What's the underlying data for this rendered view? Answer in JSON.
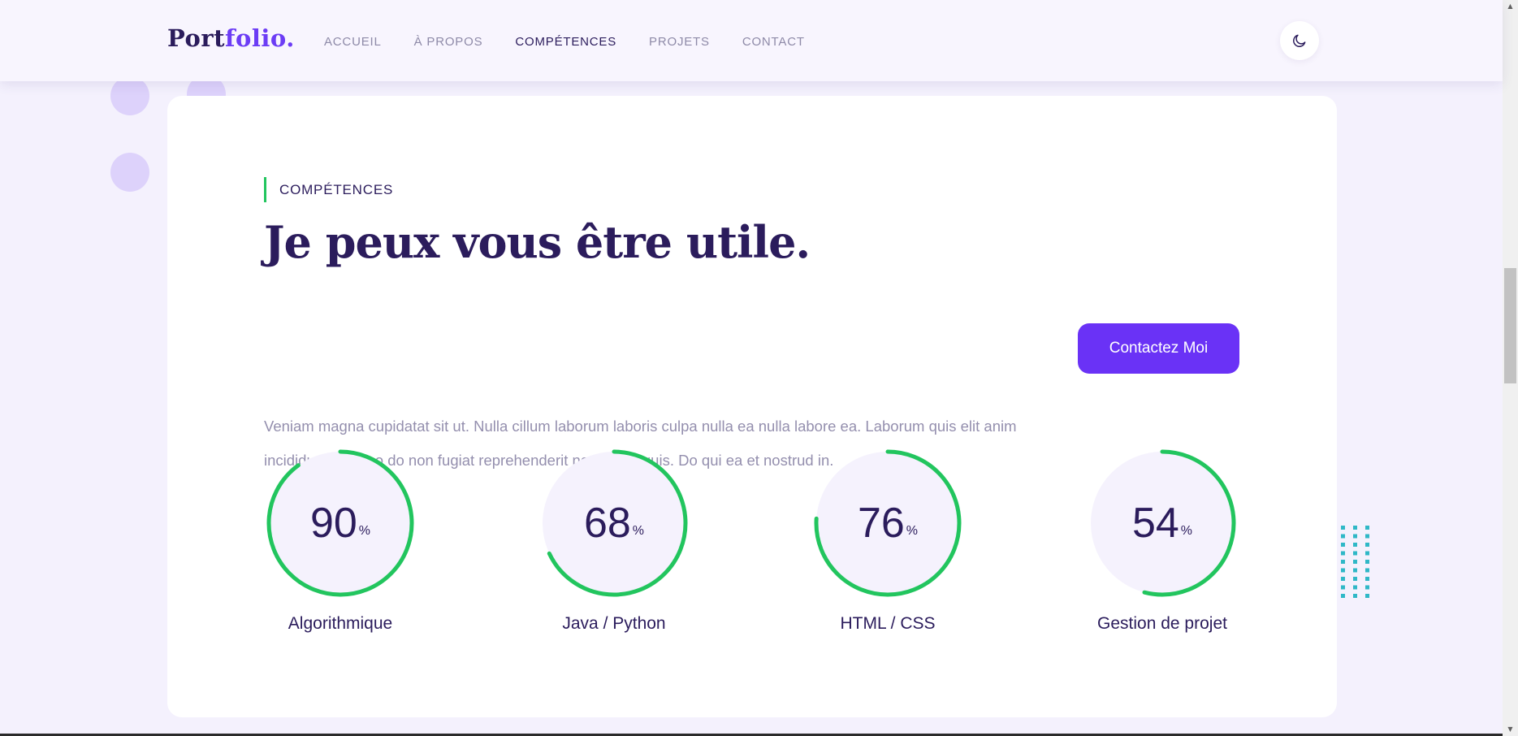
{
  "header": {
    "logo_part1": "Port",
    "logo_part2": "folio.",
    "nav": [
      {
        "label": "ACCUEIL"
      },
      {
        "label": "À PROPOS"
      },
      {
        "label": "COMPÉTENCES"
      },
      {
        "label": "PROJETS"
      },
      {
        "label": "CONTACT"
      }
    ],
    "active_nav": "COMPÉTENCES",
    "theme_toggle_icon": "moon-icon"
  },
  "skills_section": {
    "tag": "COMPÉTENCES",
    "heading": "Je peux vous être utile.",
    "description": "Veniam magna cupidatat sit ut. Nulla cillum laborum laboris culpa nulla ea nulla labore ea. Laborum quis elit anim incididunt ullamco do non fugiat reprehenderit non fugiat quis. Do qui ea et nostrud in.",
    "cta_label": "Contactez Moi",
    "percent_symbol": "%",
    "skills": [
      {
        "value": 90,
        "label": "Algorithmique"
      },
      {
        "value": 68,
        "label": "Java / Python"
      },
      {
        "value": 76,
        "label": "HTML / CSS"
      },
      {
        "value": 54,
        "label": "Gestion de projet"
      }
    ]
  },
  "colors": {
    "brand": "#6a32f6",
    "heading": "#2b1c5c",
    "progress": "#22c55e",
    "ring_track": "#f5f2fd",
    "background": "#f4f1fd",
    "dots": "#2fb8c7"
  }
}
